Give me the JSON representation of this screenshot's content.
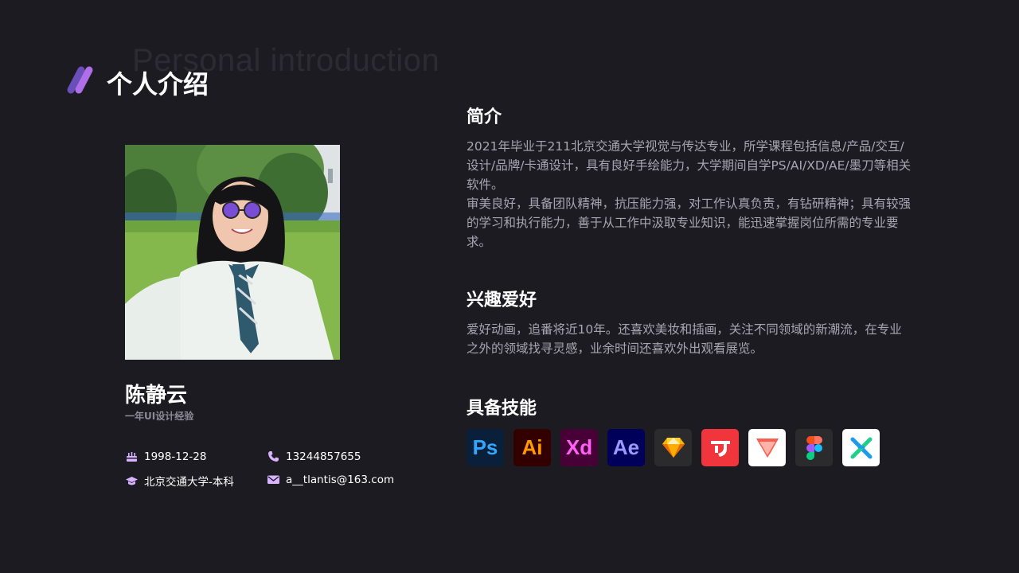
{
  "header": {
    "bg_title": "Personal introduction",
    "title": "个人介绍",
    "accent_colors": [
      "#6b4fb8",
      "#b06ee8"
    ]
  },
  "profile": {
    "name": "陈静云",
    "experience": "一年UI设计经验",
    "birthday": "1998-12-28",
    "phone": "13244857655",
    "education": "北京交通大学-本科",
    "email": "a__tlantis@163.com"
  },
  "intro": {
    "heading": "简介",
    "paragraph1": "2021年毕业于211北京交通大学视觉与传达专业，所学课程包括信息/产品/交互/设计/品牌/卡通设计，具有良好手绘能力，大学期间自学PS/AI/XD/AE/墨刀等相关软件。",
    "paragraph2": "审美良好，具备团队精神，抗压能力强，对工作认真负责，有钻研精神；具有较强的学习和执行能力，善于从工作中汲取专业知识，能迅速掌握岗位所需的专业要求。"
  },
  "hobbies": {
    "heading": "兴趣爱好",
    "text": "爱好动画，追番将近10年。还喜欢美妆和插画，关注不同领域的新潮流，在专业之外的领域找寻灵感，业余时间还喜欢外出观看展览。"
  },
  "skills": {
    "heading": "具备技能",
    "items": [
      {
        "icon": "photoshop-icon",
        "label": "Ps",
        "bg": "#0a1f3a",
        "fg": "#31a8ff"
      },
      {
        "icon": "illustrator-icon",
        "label": "Ai",
        "bg": "#330000",
        "fg": "#ff9a00"
      },
      {
        "icon": "xd-icon",
        "label": "Xd",
        "bg": "#470137",
        "fg": "#ff61f6"
      },
      {
        "icon": "after-effects-icon",
        "label": "Ae",
        "bg": "#00005b",
        "fg": "#9999ff"
      },
      {
        "icon": "sketch-icon",
        "bg": "#2b2b2e"
      },
      {
        "icon": "modao-icon",
        "bg": "#f0353d"
      },
      {
        "icon": "axure-layers-icon",
        "bg": "#ffffff"
      },
      {
        "icon": "figma-icon",
        "bg": "#2b2b2e"
      },
      {
        "icon": "xmind-icon",
        "bg": "#ffffff"
      }
    ]
  }
}
